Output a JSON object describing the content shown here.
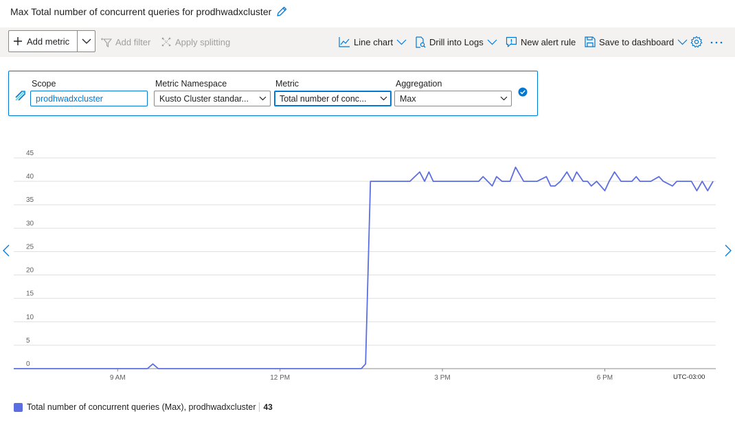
{
  "header": {
    "title": "Max Total number of concurrent queries for prodhwadxcluster"
  },
  "toolbar": {
    "add_metric": "Add metric",
    "add_filter": "Add filter",
    "apply_splitting": "Apply splitting",
    "line_chart": "Line chart",
    "drill_logs": "Drill into Logs",
    "new_alert": "New alert rule",
    "save_dashboard": "Save to dashboard"
  },
  "metric_row": {
    "scope_label": "Scope",
    "scope_value": "prodhwadxcluster",
    "namespace_label": "Metric Namespace",
    "namespace_value": "Kusto Cluster standar...",
    "metric_label": "Metric",
    "metric_value": "Total number of conc...",
    "aggregation_label": "Aggregation",
    "aggregation_value": "Max"
  },
  "colors": {
    "accent": "#0078d4",
    "series": "#5b6ee1"
  },
  "chart_data": {
    "type": "line",
    "y_ticks": [
      "0",
      "5",
      "10",
      "15",
      "20",
      "25",
      "30",
      "35",
      "40",
      "45"
    ],
    "ylim": [
      0,
      45
    ],
    "x_ticks": [
      "9 AM",
      "12 PM",
      "3 PM",
      "6 PM"
    ],
    "x_tick_hours": [
      9,
      12,
      15,
      18
    ],
    "xlim_hours": [
      7.08,
      20.05
    ],
    "timezone": "UTC-03:00",
    "series": [
      {
        "name": "Total number of concurrent queries (Max), prodhwadxcluster",
        "summary_value": "43",
        "x_hours": [
          7.08,
          9.55,
          9.65,
          9.75,
          13.5,
          13.58,
          13.67,
          14.4,
          14.58,
          14.67,
          14.75,
          14.83,
          14.92,
          15.67,
          15.75,
          15.92,
          16.0,
          16.1,
          16.25,
          16.35,
          16.5,
          16.65,
          16.75,
          16.92,
          17.0,
          17.08,
          17.18,
          17.3,
          17.4,
          17.48,
          17.6,
          17.68,
          17.75,
          17.85,
          18.0,
          18.08,
          18.18,
          18.3,
          18.5,
          18.58,
          18.65,
          18.75,
          18.85,
          19.0,
          19.08,
          19.25,
          19.33,
          19.42,
          19.5,
          19.6,
          19.7,
          19.8,
          19.9,
          20.0
        ],
        "values": [
          0,
          0,
          1,
          0,
          0,
          1,
          40,
          40,
          42,
          40,
          42,
          40,
          40,
          40,
          41,
          39,
          41,
          40,
          40,
          43,
          40,
          40,
          40,
          41,
          39,
          39,
          40,
          42,
          40,
          42,
          40,
          40,
          39,
          40,
          38,
          40,
          42,
          40,
          40,
          41,
          40,
          40,
          40,
          41,
          40,
          39,
          40,
          40,
          40,
          40,
          38,
          40,
          38,
          40
        ]
      }
    ]
  }
}
